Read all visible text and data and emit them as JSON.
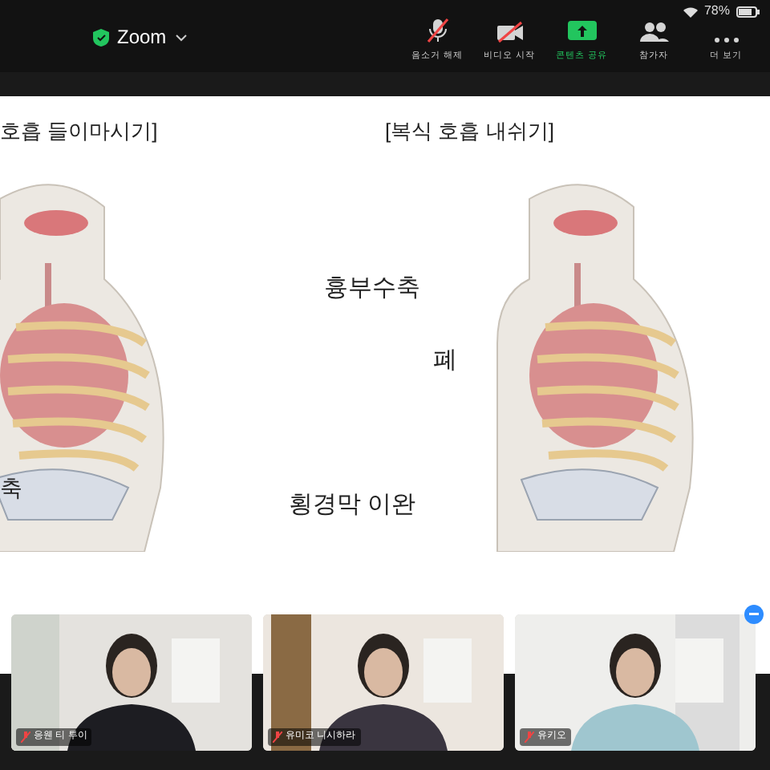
{
  "status_bar": {
    "battery": "78%"
  },
  "meeting": {
    "title": "Zoom"
  },
  "toolbar": [
    {
      "label": "음소거 해제",
      "kind": "mic-off",
      "active": false
    },
    {
      "label": "비디오 시작",
      "kind": "video-off",
      "active": false
    },
    {
      "label": "콘텐츠 공유",
      "kind": "share",
      "active": true
    },
    {
      "label": "참가자",
      "kind": "people",
      "active": false
    },
    {
      "label": "더 보기",
      "kind": "more",
      "active": false
    }
  ],
  "slide": {
    "left_title": "호흡 들이마시기]",
    "right_title": "[복식 호흡  내쉬기]",
    "left_labels": [
      "축"
    ],
    "right_labels": [
      "흉부수축",
      "폐",
      "횡경막 이완"
    ]
  },
  "participants": [
    {
      "name": "응웬 티 투이",
      "muted": true
    },
    {
      "name": "유미코 니시하라",
      "muted": true
    },
    {
      "name": "유키오",
      "muted": true
    }
  ]
}
